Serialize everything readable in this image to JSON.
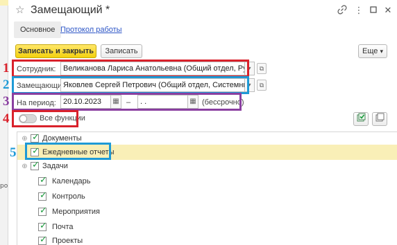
{
  "background": {
    "side_text": "ро"
  },
  "window": {
    "title": "Замещающий",
    "title_modified": "*",
    "icons": [
      "link-icon",
      "more-vert-icon",
      "maximize-icon",
      "close-icon"
    ]
  },
  "tabs": {
    "main": "Основное",
    "link": "Протокол работы"
  },
  "toolbar": {
    "save_close": "Записать и закрыть",
    "save": "Записать",
    "more": "Еще",
    "more_arrow": "▾"
  },
  "form": {
    "employee_label": "Сотрудник:",
    "employee_value": "Великанова Лариса Анатольевна (Общий отдел, Руководит",
    "substitute_label": "Замещающий:",
    "substitute_value": "Яковлев Сергей Петрович (Общий отдел, Системный админ",
    "period_label": "На период:",
    "date_from": "20.10.2023",
    "date_sep": "–",
    "date_to": " .  .",
    "period_note": "(бессрочно)",
    "all_functions_label": "Все функции"
  },
  "annotations": {
    "n1": "1",
    "n2": "2",
    "n3": "3",
    "n4": "4",
    "n5": "5",
    "color_red": "#d9212b",
    "color_blue": "#1e9ad6",
    "color_purple": "#8a3fa0"
  },
  "functions": [
    {
      "label": "Документы",
      "checked": true,
      "expandable": true,
      "selected": false
    },
    {
      "label": "Ежедневные отчеты",
      "checked": true,
      "expandable": false,
      "selected": true
    },
    {
      "label": "Задачи",
      "checked": true,
      "expandable": true,
      "selected": false
    },
    {
      "label": "Календарь",
      "checked": true,
      "expandable": false,
      "selected": false
    },
    {
      "label": "Контроль",
      "checked": true,
      "expandable": false,
      "selected": false
    },
    {
      "label": "Мероприятия",
      "checked": true,
      "expandable": false,
      "selected": false
    },
    {
      "label": "Почта",
      "checked": true,
      "expandable": false,
      "selected": false
    },
    {
      "label": "Проекты",
      "checked": true,
      "expandable": false,
      "selected": false
    }
  ]
}
